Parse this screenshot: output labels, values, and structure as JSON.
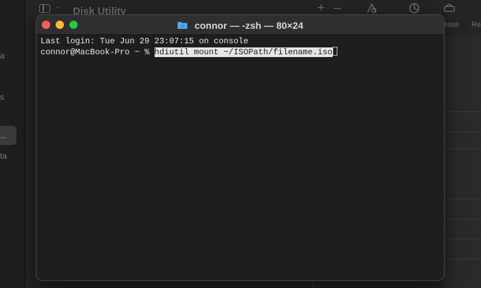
{
  "background_app": {
    "title": "Disk Utility",
    "sidebar_fragments": [
      "a",
      "s",
      "...",
      "ta"
    ],
    "toolbar": {
      "add_symbol": "+",
      "remove_symbol": "–",
      "erase_label": "rase",
      "restore_label": "Re"
    }
  },
  "terminal": {
    "window_title": "connor — -zsh — 80×24",
    "last_login": "Last login: Tue Jun 29 23:07:15 on console",
    "prompt": "connor@MacBook-Pro ~ % ",
    "command": "hdiutil mount ~/ISOPath/filename.iso"
  },
  "colors": {
    "close": "#ff5f57",
    "minimize": "#febc2e",
    "maximize": "#28c840",
    "folder": "#5aa9e6"
  }
}
